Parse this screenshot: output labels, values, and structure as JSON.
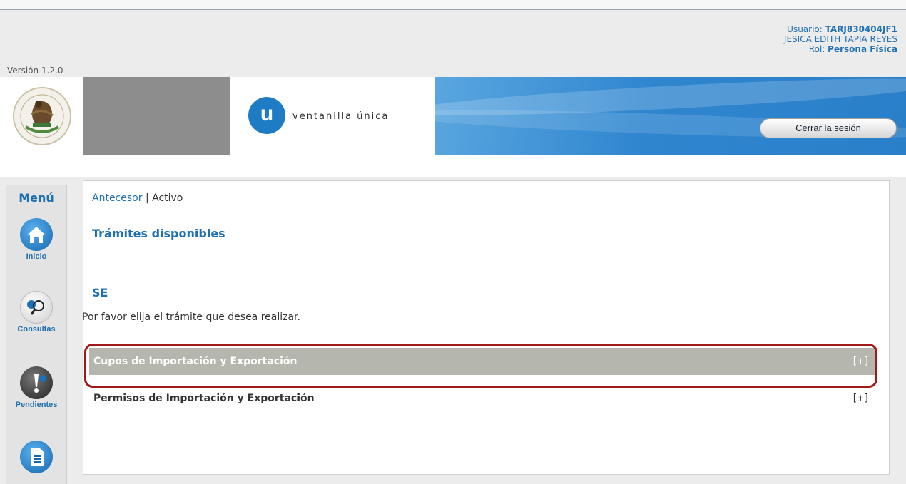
{
  "header": {
    "user_label": "Usuario:",
    "user_id": "TARJ830404JF1",
    "user_name": "JESICA EDITH TAPIA REYES",
    "role_label": "Rol:",
    "role_value": "Persona Física",
    "version": "Versión 1.2.0"
  },
  "banner": {
    "seal_icon": "mexican-coat-of-arms-seal",
    "brand_letter": "u",
    "brand_name": "ventanilla única",
    "logout_label": "Cerrar la sesión"
  },
  "sidebar": {
    "title": "Menú",
    "items": [
      {
        "label": "Inicio",
        "icon": "home-icon"
      },
      {
        "label": "Consultas",
        "icon": "magnifier-icon"
      },
      {
        "label": "Pendientes",
        "icon": "exclamation-icon"
      },
      {
        "label": "",
        "icon": "document-icon"
      }
    ]
  },
  "main": {
    "breadcrumb_link": "Antecesor",
    "breadcrumb_separator": "|",
    "breadcrumb_current": "Activo",
    "title": "Trámites disponibles",
    "dependency": "SE",
    "instructions": "Por favor elija el trámite que desea realizar.",
    "tramites": [
      {
        "label": "Cupos de Importación y Exportación",
        "toggle": "[+]",
        "highlighted": true
      },
      {
        "label": "Permisos de Importación y Exportación",
        "toggle": "[+]",
        "highlighted": false
      }
    ]
  },
  "colors": {
    "accent": "#1e6fb3",
    "highlight_border": "#a01818",
    "selected_row": "#b5b7ae"
  }
}
